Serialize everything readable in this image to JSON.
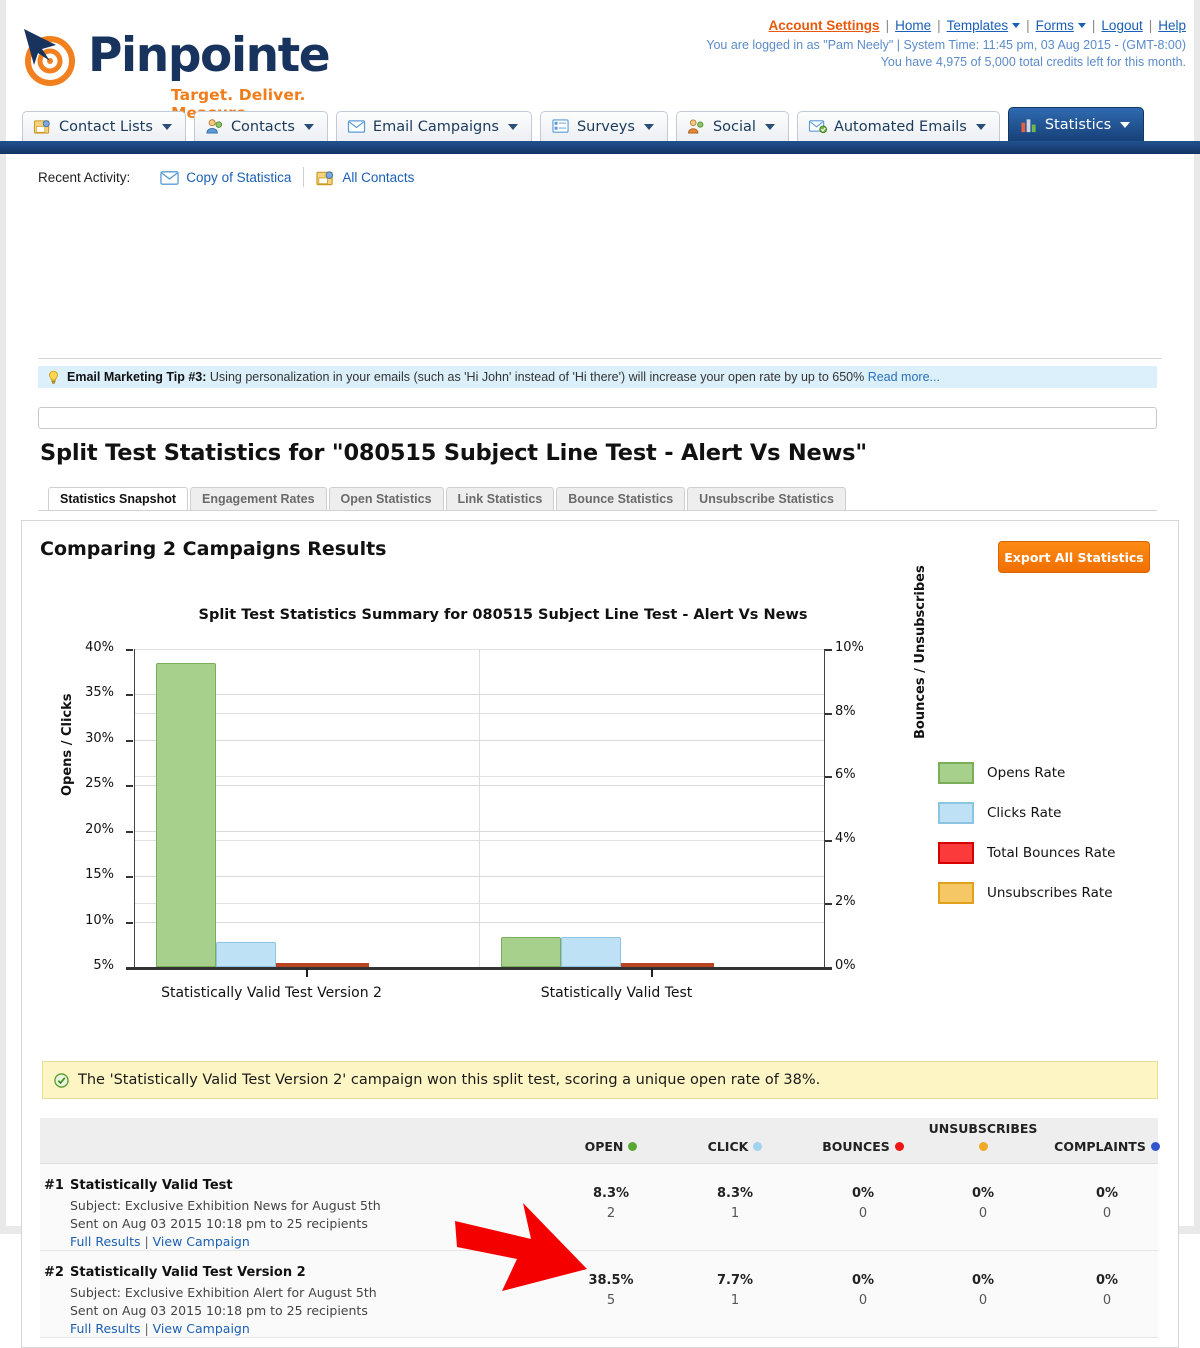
{
  "brand": {
    "name": "Pinpointe",
    "tagline": "Target. Deliver. Measure.",
    "accent_color": "#f07d1b",
    "text_color": "#17335e"
  },
  "header": {
    "links": [
      {
        "label": "Account Settings",
        "accent": true,
        "caret": false
      },
      {
        "label": "Home",
        "accent": false,
        "caret": false
      },
      {
        "label": "Templates",
        "accent": false,
        "caret": true
      },
      {
        "label": "Forms",
        "accent": false,
        "caret": true
      },
      {
        "label": "Logout",
        "accent": false,
        "caret": false
      },
      {
        "label": "Help",
        "accent": false,
        "caret": false
      }
    ],
    "separator": "|",
    "status_line_1": "You are logged in as \"Pam Neely\" | System Time: 11:45 pm, 03 Aug 2015 - (GMT-8:00)",
    "status_line_2": "You have 4,975 of 5,000 total credits left for this month."
  },
  "nav": {
    "tabs": [
      {
        "label": "Contact Lists",
        "icon": "contact-lists-icon",
        "active": false
      },
      {
        "label": "Contacts",
        "icon": "contacts-icon",
        "active": false
      },
      {
        "label": "Email Campaigns",
        "icon": "envelope-icon",
        "active": false
      },
      {
        "label": "Surveys",
        "icon": "survey-icon",
        "active": false
      },
      {
        "label": "Social",
        "icon": "social-icon",
        "active": false
      },
      {
        "label": "Automated Emails",
        "icon": "automated-email-icon",
        "active": false
      },
      {
        "label": "Statistics",
        "icon": "bar-chart-icon",
        "active": true
      }
    ]
  },
  "recent_activity": {
    "label": "Recent Activity:",
    "items": [
      {
        "label": "Copy of Statistica",
        "icon": "envelope-icon"
      },
      {
        "label": "All Contacts",
        "icon": "contact-lists-icon"
      }
    ]
  },
  "tip": {
    "icon": "lightbulb-icon",
    "heading": "Email Marketing Tip #3:",
    "body": "Using personalization in your emails (such as 'Hi John' instead of 'Hi there') will increase your open rate by up to 650%",
    "link": "Read more..."
  },
  "search": {
    "value": "",
    "placeholder": ""
  },
  "page": {
    "title": "Split Test Statistics for \"080515 Subject Line Test - Alert Vs News\"",
    "subtabs": [
      {
        "label": "Statistics Snapshot",
        "active": true
      },
      {
        "label": "Engagement Rates",
        "active": false
      },
      {
        "label": "Open Statistics",
        "active": false
      },
      {
        "label": "Link Statistics",
        "active": false
      },
      {
        "label": "Bounce Statistics",
        "active": false
      },
      {
        "label": "Unsubscribe Statistics",
        "active": false
      }
    ],
    "section_heading": "Comparing 2 Campaigns Results",
    "export_button": "Export All Statistics"
  },
  "winner": {
    "icon": "check-circle-icon",
    "message": "The 'Statistically Valid Test Version 2' campaign won this split test, scoring a unique open rate of 38%."
  },
  "chart_data": {
    "type": "bar",
    "title": "Split Test Statistics Summary for 080515 Subject Line Test - Alert Vs News",
    "categories": [
      "Statistically Valid Test Version 2",
      "Statistically Valid Test"
    ],
    "series": [
      {
        "name": "Opens Rate",
        "color": "#a8d08d",
        "border": "#7aad5a",
        "axis": "left",
        "values": [
          38.5,
          8.3
        ]
      },
      {
        "name": "Clicks Rate",
        "color": "#bfe1f5",
        "border": "#8fc3e2",
        "axis": "left",
        "values": [
          7.7,
          8.3
        ]
      },
      {
        "name": "Total Bounces Rate",
        "color": "#fb3b3b",
        "border": "#d40000",
        "axis": "right",
        "values": [
          0,
          0
        ]
      },
      {
        "name": "Unsubscribes Rate",
        "color": "#f5c765",
        "border": "#e0a21c",
        "axis": "right",
        "values": [
          0,
          0
        ]
      }
    ],
    "ylabel": "Opens / Clicks",
    "y2label": "Bounces / Unsubscribes",
    "xlabel": "",
    "ylim": [
      5,
      40
    ],
    "y2lim": [
      0,
      10
    ],
    "yticks": [
      "40%",
      "35%",
      "30%",
      "25%",
      "20%",
      "15%",
      "10%",
      "5%"
    ],
    "ytick_values": [
      40,
      35,
      30,
      25,
      20,
      15,
      10,
      5
    ],
    "y2ticks": [
      "10%",
      "8%",
      "6%",
      "4%",
      "2%",
      "0%"
    ],
    "y2tick_values": [
      10,
      8,
      6,
      4,
      2,
      0
    ],
    "grid": true,
    "legend_position": "right",
    "legend": [
      "Opens Rate",
      "Clicks Rate",
      "Total Bounces Rate",
      "Unsubscribes Rate"
    ]
  },
  "results_table": {
    "columns": [
      {
        "label": "OPEN",
        "dot": "#5aa832"
      },
      {
        "label": "CLICK",
        "dot": "#9fd3ee"
      },
      {
        "label": "BOUNCES",
        "dot": "#f01414"
      },
      {
        "label": "UNSUBSCRIBES",
        "dot": "#f0a924"
      },
      {
        "label": "COMPLAINTS",
        "dot": "#3355cc"
      }
    ],
    "rows": [
      {
        "rank": "#1",
        "name": "Statistically Valid Test",
        "subject": "Subject: Exclusive Exhibition News for August 5th",
        "sent": "Sent on Aug 03 2015 10:18 pm to 25 recipients",
        "link_full": "Full Results",
        "link_sep": "|",
        "link_view": "View Campaign",
        "metrics": [
          {
            "pct": "8.3%",
            "count": "2"
          },
          {
            "pct": "8.3%",
            "count": "1"
          },
          {
            "pct": "0%",
            "count": "0"
          },
          {
            "pct": "0%",
            "count": "0"
          },
          {
            "pct": "0%",
            "count": "0"
          }
        ]
      },
      {
        "rank": "#2",
        "name": "Statistically Valid Test Version 2",
        "subject": "Subject: Exclusive Exhibition Alert for August 5th",
        "sent": "Sent on Aug 03 2015 10:18 pm to 25 recipients",
        "link_full": "Full Results",
        "link_sep": "|",
        "link_view": "View Campaign",
        "metrics": [
          {
            "pct": "38.5%",
            "count": "5"
          },
          {
            "pct": "7.7%",
            "count": "1"
          },
          {
            "pct": "0%",
            "count": "0"
          },
          {
            "pct": "0%",
            "count": "0"
          },
          {
            "pct": "0%",
            "count": "0"
          }
        ]
      }
    ]
  },
  "annotation": {
    "shape": "red-arrow",
    "color": "#f40000",
    "points_at": "38.5%"
  }
}
